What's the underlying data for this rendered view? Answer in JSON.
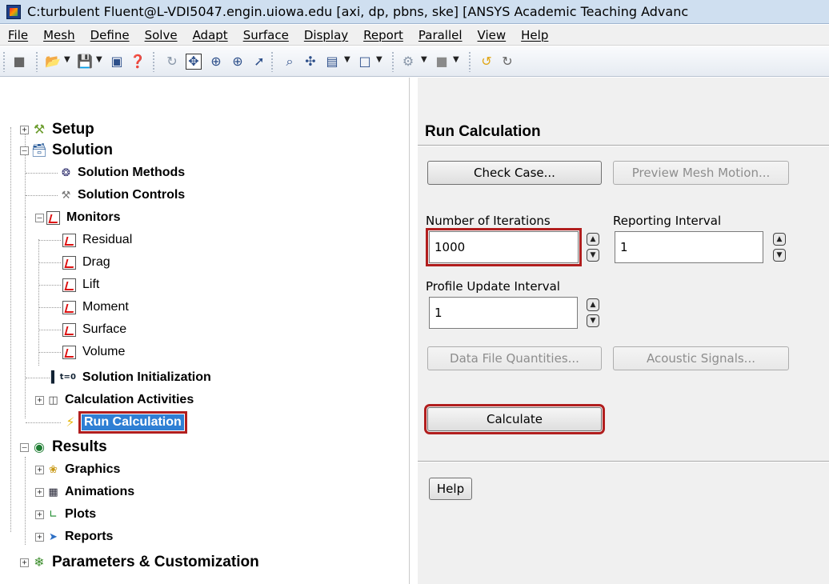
{
  "window": {
    "title": "C:turbulent Fluent@L-VDI5047.engin.uiowa.edu  [axi, dp, pbns, ske] [ANSYS Academic Teaching Advanc",
    "icon": "fluent-app-icon"
  },
  "menu": [
    "File",
    "Mesh",
    "Define",
    "Solve",
    "Adapt",
    "Surface",
    "Display",
    "Report",
    "Parallel",
    "View",
    "Help"
  ],
  "toolbar": {
    "icons": [
      "module-icon",
      "open-icon",
      "save-icon",
      "screenshot-icon",
      "help-icon",
      "rotate-icon",
      "pan-icon",
      "zoom-in-icon",
      "zoom-box-icon",
      "probe-icon",
      "fit-icon",
      "mouse-mode-icon",
      "layout-icon",
      "window-icon",
      "graphics-icon",
      "color-icon",
      "refresh-icon",
      "reload-icon"
    ]
  },
  "tree": {
    "setup": "Setup",
    "solution": "Solution",
    "solution_methods": "Solution Methods",
    "solution_controls": "Solution Controls",
    "monitors": "Monitors",
    "monitor_items": [
      "Residual",
      "Drag",
      "Lift",
      "Moment",
      "Surface",
      "Volume"
    ],
    "solution_initialization": "Solution Initialization",
    "calculation_activities": "Calculation Activities",
    "run_calculation": "Run Calculation",
    "results": "Results",
    "graphics": "Graphics",
    "animations": "Animations",
    "plots": "Plots",
    "reports": "Reports",
    "parameters": "Parameters & Customization",
    "subscript": "t=0"
  },
  "panel": {
    "title": "Run Calculation",
    "check_case": "Check Case...",
    "preview_mesh_motion": "Preview Mesh Motion...",
    "iterations_label": "Number of Iterations",
    "iterations_value": "1000",
    "reporting_label": "Reporting Interval",
    "reporting_value": "1",
    "profile_label": "Profile Update Interval",
    "profile_value": "1",
    "data_file_quantities": "Data File Quantities...",
    "acoustic_signals": "Acoustic Signals...",
    "calculate": "Calculate",
    "help": "Help"
  },
  "colors": {
    "highlight_border": "#b11e1e",
    "selection": "#2f7fd4"
  }
}
